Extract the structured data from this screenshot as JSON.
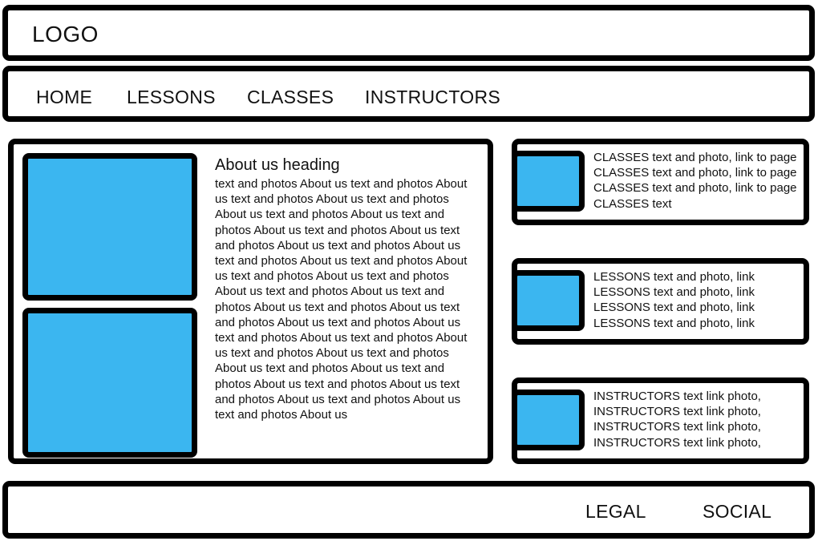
{
  "header": {
    "logo": "LOGO"
  },
  "nav": {
    "items": [
      {
        "label": "HOME"
      },
      {
        "label": "LESSONS"
      },
      {
        "label": "CLASSES"
      },
      {
        "label": "INSTRUCTORS"
      }
    ]
  },
  "about": {
    "heading": "About us heading",
    "body": "text and photos About us text and photos About us text and photos About us text and photos About us text and photos About us text and photos About us text and photos About us text and photos About us text and photos About us text and photos About us text and photos About us text and photos About us text and photos About us text and photos About us text and photos About us text and photos About us text and photos About us text and photos About us text and photos About us text and photos About us text and photos About us text and photos About us text and photos About us text and photos About us text and photos About us text and photos About us text and photos About us text and photos About us"
  },
  "cards": {
    "classes": {
      "text": "CLASSES text and photo, link to page CLASSES text and photo, link to page CLASSES text and photo, link to page CLASSES text"
    },
    "lessons": {
      "text": "LESSONS text and photo, link\nLESSONS text and photo, link\nLESSONS text and photo, link\nLESSONS text and photo, link"
    },
    "instructors": {
      "text": "INSTRUCTORS text link photo,\nINSTRUCTORS text link  photo,\nINSTRUCTORS text link  photo,\nINSTRUCTORS text link  photo,"
    }
  },
  "footer": {
    "legal": "LEGAL",
    "social": "SOCIAL"
  },
  "colors": {
    "photo_placeholder": "#3bb6f0",
    "border": "#000000",
    "background": "#ffffff"
  }
}
